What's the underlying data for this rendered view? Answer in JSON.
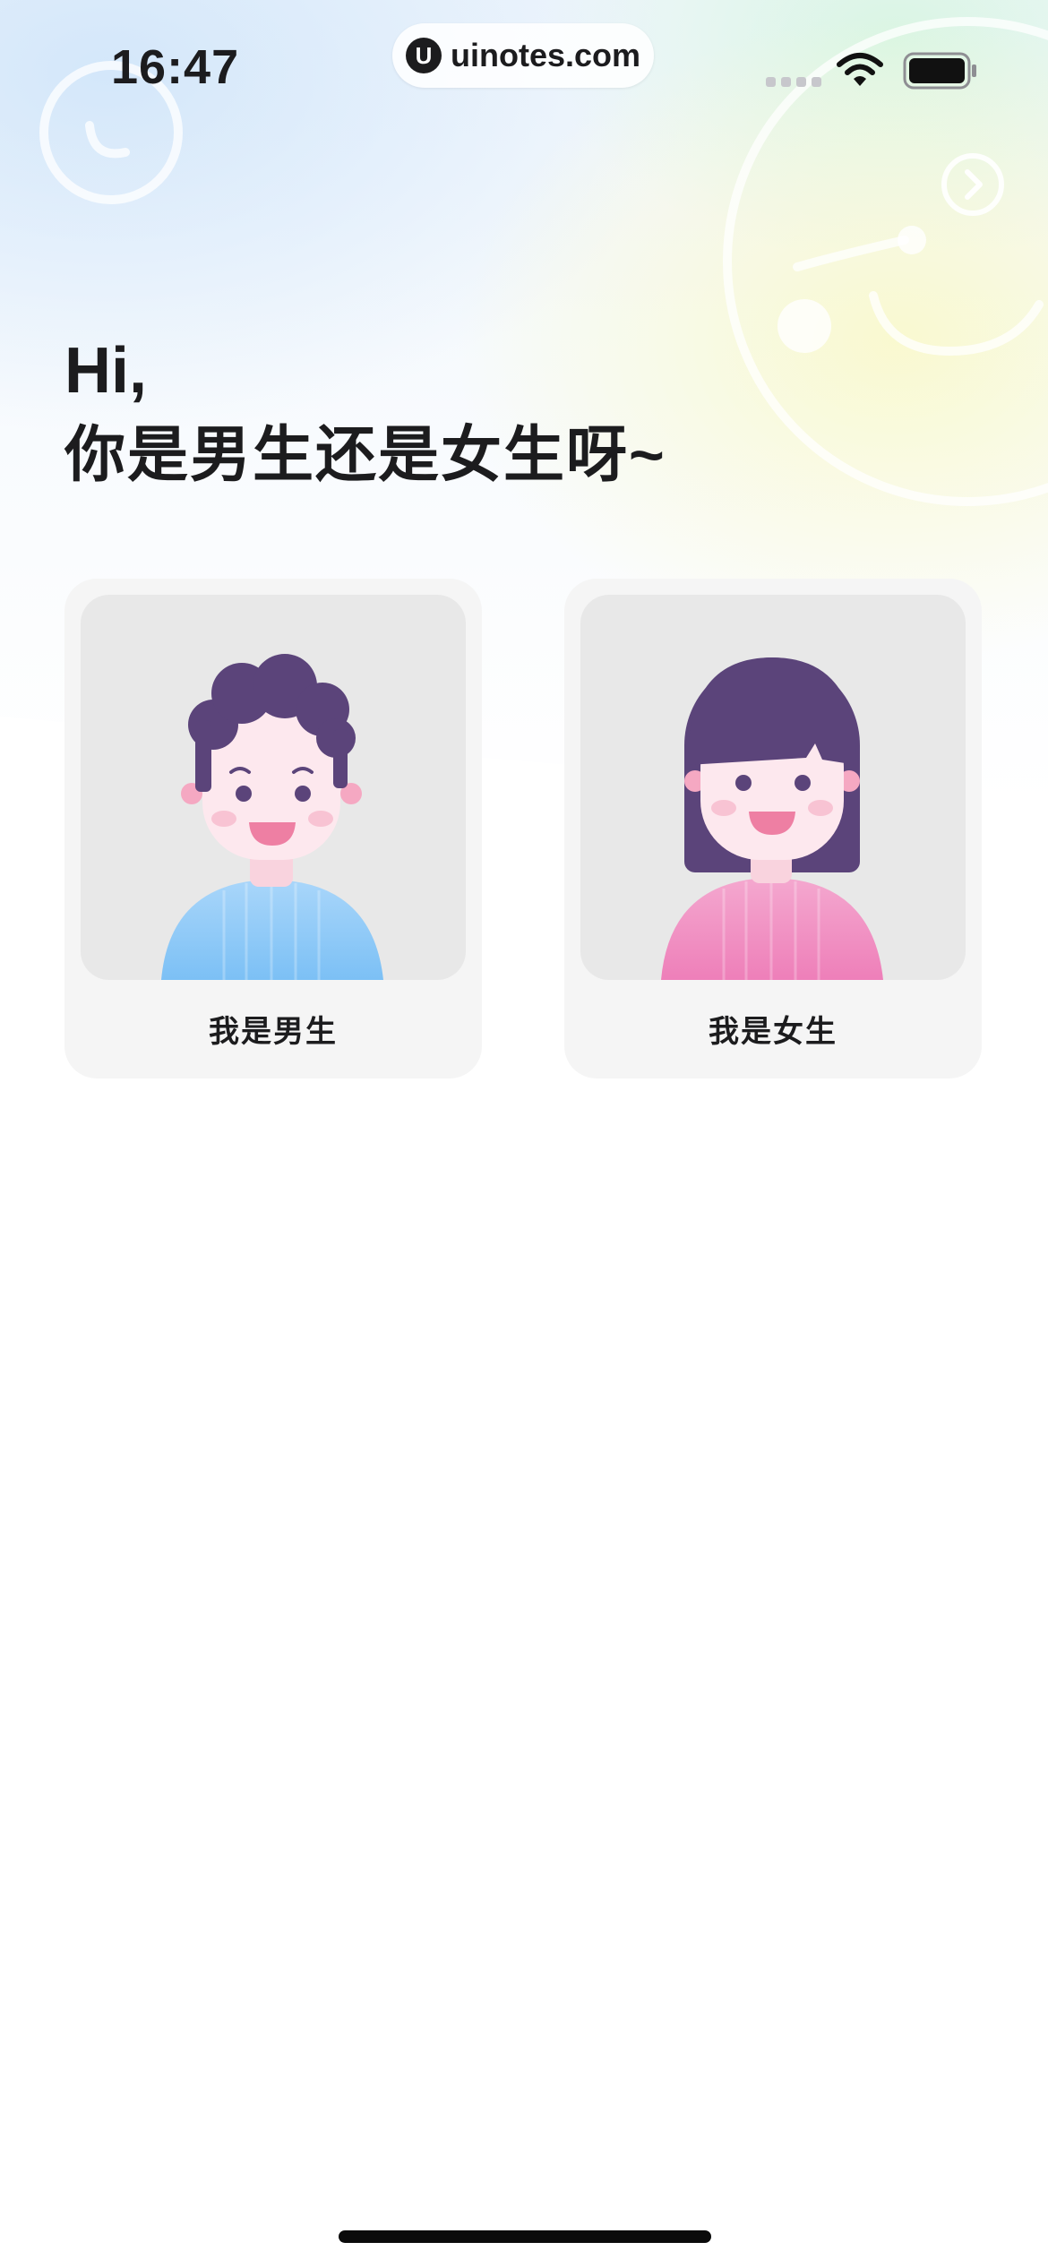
{
  "status_bar": {
    "time": "16:47",
    "url": "uinotes.com",
    "icons": [
      "cellular-signal-icon",
      "wifi-icon",
      "battery-icon"
    ]
  },
  "header": {
    "greeting": "Hi,",
    "question": "你是男生还是女生呀~"
  },
  "options": [
    {
      "label": "我是男生",
      "avatar": "boy-avatar",
      "accent": "#7cc0f5"
    },
    {
      "label": "我是女生",
      "avatar": "girl-avatar",
      "accent": "#ee7fb9"
    }
  ],
  "colors": {
    "hair": "#5b447a",
    "skin": "#fde8ee",
    "card_bg": "#f5f5f5",
    "frame_bg": "#e8e8e8"
  }
}
